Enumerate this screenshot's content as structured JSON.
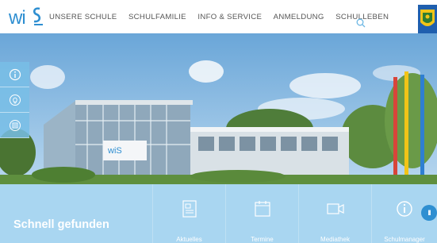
{
  "brand": {
    "logo_text": "wiS",
    "accent": "#2f8fd1",
    "quick_bg": "#a9d6f1"
  },
  "nav": {
    "items": [
      {
        "label": "UNSERE SCHULE"
      },
      {
        "label": "SCHULFAMILIE"
      },
      {
        "label": "INFO & SERVICE"
      },
      {
        "label": "ANMELDUNG"
      },
      {
        "label": "SCHULLEBEN"
      }
    ],
    "search_icon": "search-icon",
    "crest_icon": "coat-of-arms-icon"
  },
  "side_buttons": [
    {
      "icon": "info-icon"
    },
    {
      "icon": "lightbulb-icon"
    },
    {
      "icon": "menu-card-icon"
    }
  ],
  "quick": {
    "title": "Schnell gefunden",
    "tiles": [
      {
        "label": "Aktuelles",
        "icon": "newspaper-icon"
      },
      {
        "label": "Termine",
        "icon": "calendar-icon"
      },
      {
        "label": "Mediathek",
        "icon": "video-icon"
      },
      {
        "label": "Schulmanager",
        "icon": "info-icon"
      }
    ],
    "pause_label": "II"
  }
}
